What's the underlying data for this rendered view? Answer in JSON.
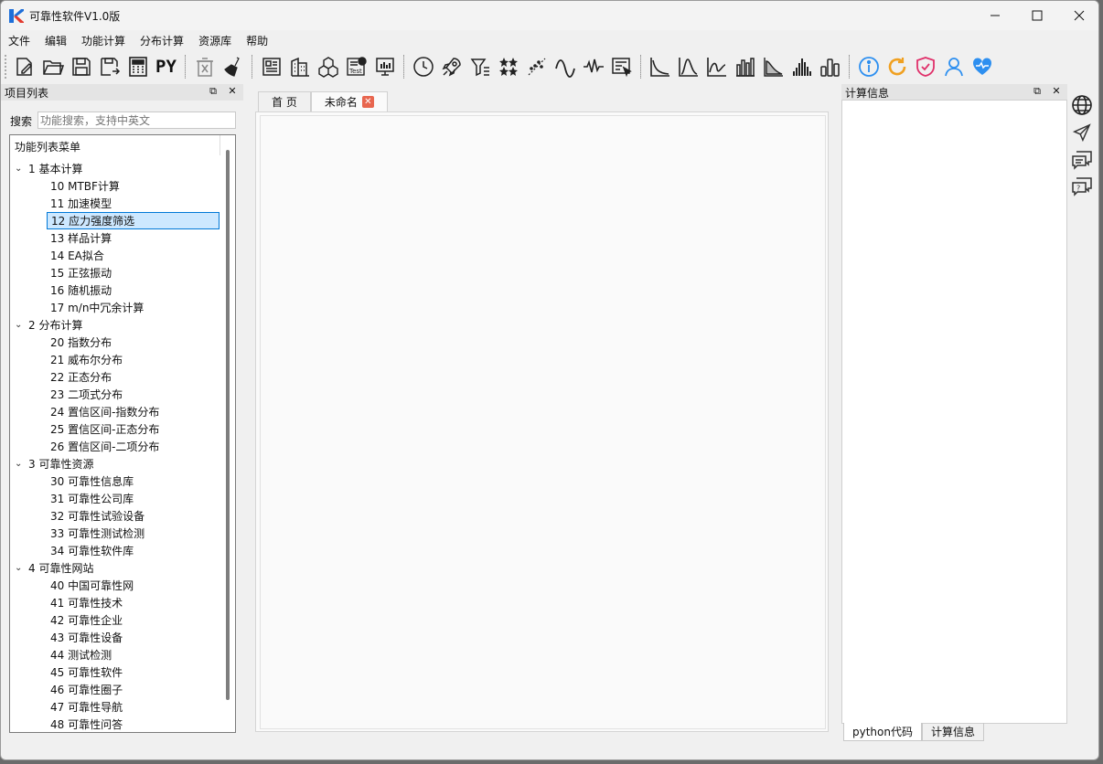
{
  "app": {
    "title": "可靠性软件V1.0版"
  },
  "menu": [
    "文件",
    "编辑",
    "功能计算",
    "分布计算",
    "资源库",
    "帮助"
  ],
  "toolbar": {
    "groups": [
      [
        "new-file-icon",
        "open-folder-icon",
        "save-icon",
        "save-as-icon",
        "calculator-icon",
        "python-icon"
      ],
      [
        "delete-icon",
        "clear-broom-icon"
      ],
      [
        "report-icon",
        "building-icon",
        "cubes-icon",
        "test-icon",
        "monitor-chart-icon"
      ],
      [
        "clock-icon",
        "rocket-icon",
        "filter-icon",
        "stars-icon",
        "scatter-line-icon",
        "sine-wave-icon",
        "pulse-wave-icon",
        "form-icon"
      ],
      [
        "exponential-curve-icon",
        "peak-curve-icon",
        "line-curve-icon",
        "bar-chart-icon",
        "decay-area-icon",
        "histogram-icon",
        "bar-outline-icon"
      ],
      [
        "info-icon",
        "refresh-icon",
        "shield-check-icon",
        "user-icon",
        "heart-icon"
      ]
    ],
    "python_label": "PY"
  },
  "left_panel": {
    "title": "项目列表",
    "search_label": "搜索",
    "search_placeholder": "功能搜索，支持中英文",
    "tree_header": "功能列表菜单",
    "categories": [
      {
        "label": "1 基本计算",
        "items": [
          "10 MTBF计算",
          "11 加速模型",
          "12 应力强度筛选",
          "13 样品计算",
          "14 EA拟合",
          "15 正弦振动",
          "16 随机振动",
          "17 m/n中冗余计算"
        ]
      },
      {
        "label": "2 分布计算",
        "items": [
          "20 指数分布",
          "21 威布尔分布",
          "22 正态分布",
          "23 二项式分布",
          "24 置信区间-指数分布",
          "25 置信区间-正态分布",
          "26 置信区间-二项分布"
        ]
      },
      {
        "label": "3 可靠性资源",
        "items": [
          "30 可靠性信息库",
          "31 可靠性公司库",
          "32 可靠性试验设备",
          "33 可靠性测试检测",
          "34 可靠性软件库"
        ]
      },
      {
        "label": "4 可靠性网站",
        "items": [
          "40 中国可靠性网",
          "41 可靠性技术",
          "42 可靠性企业",
          "43 可靠性设备",
          "44 测试检测",
          "45 可靠性软件",
          "46 可靠性圈子",
          "47 可靠性导航",
          "48 可靠性问答"
        ]
      }
    ],
    "selected_item": "12 应力强度筛选"
  },
  "tabs": [
    "首 页",
    "未命名"
  ],
  "right_panel": {
    "title": "计算信息"
  },
  "bottom_tabs": [
    "python代码",
    "计算信息"
  ],
  "side_icons": [
    "globe-icon",
    "send-icon",
    "comments-icon",
    "help-chat-icon"
  ],
  "colors": {
    "selection": "#cde8ff",
    "selection_border": "#0078d7",
    "tab_close": "#e8664f",
    "info": "#2d8ff0",
    "refresh": "#f0a020",
    "shield": "#e0306a",
    "user": "#2d8ff0"
  }
}
